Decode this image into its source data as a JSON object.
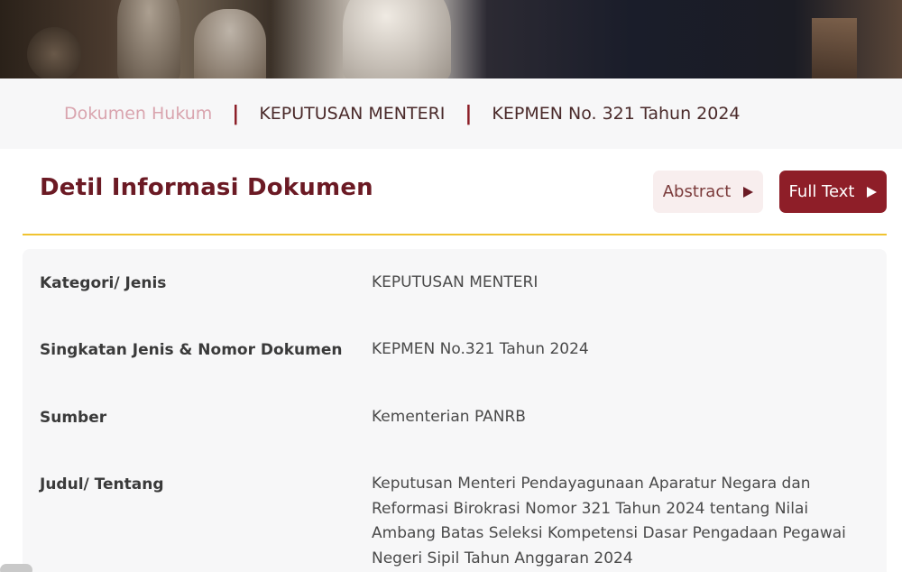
{
  "breadcrumb": {
    "home": "Dokumen Hukum",
    "separator": "|",
    "level1": "KEPUTUSAN MENTERI",
    "level2": "KEPMEN No. 321 Tahun 2024"
  },
  "header": {
    "title": "Detil Informasi Dokumen",
    "abstract_label": "Abstract",
    "fulltext_label": "Full Text"
  },
  "details": [
    {
      "label": "Kategori/ Jenis",
      "value": "KEPUTUSAN MENTERI"
    },
    {
      "label": "Singkatan Jenis & Nomor Dokumen",
      "value": "KEPMEN No.321 Tahun 2024"
    },
    {
      "label": "Sumber",
      "value": "Kementerian PANRB"
    },
    {
      "label": "Judul/ Tentang",
      "value": "Keputusan Menteri Pendayagunaan Aparatur Negara dan Reformasi Birokrasi Nomor 321 Tahun 2024 tentang Nilai Ambang Batas Seleksi Kompetensi Dasar Pengadaan Pegawai Negeri Sipil Tahun Anggaran 2024"
    }
  ],
  "colors": {
    "accent": "#8e1e28",
    "title": "#6b1a24",
    "divider": "#f0c330",
    "breadcrumb_home": "#d9a4ae"
  },
  "icons": {
    "play": "play-triangle-icon"
  }
}
